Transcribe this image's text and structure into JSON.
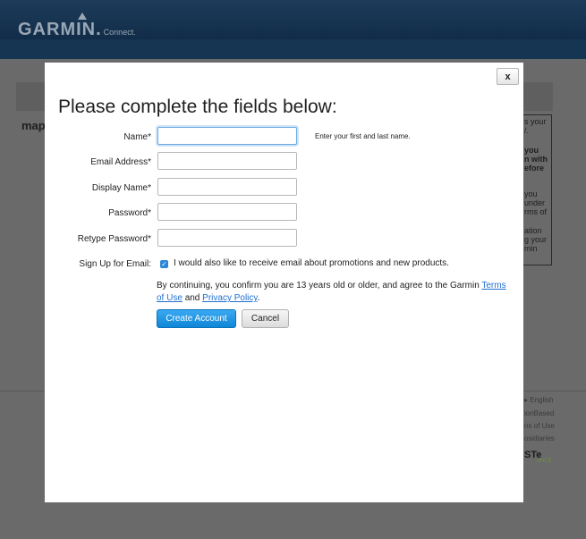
{
  "background": {
    "logo": "GARMIN.",
    "logo_sub": "Connect.",
    "left_text": "map",
    "right_panel_lines": [
      "s your",
      "/.",
      "",
      "you",
      "n with",
      "efore",
      "",
      "you",
      "under",
      "rms of",
      "",
      "ation",
      "g your",
      "min"
    ],
    "footer_lines": [
      "▸ English",
      "ionBased",
      "ns of Use",
      "osidiaries"
    ],
    "footer_logo": "STe",
    "footer_logo_sub": "ANCE"
  },
  "modal": {
    "close_label": "x",
    "title": "Please complete the fields below:",
    "fields": [
      {
        "label": "Name*",
        "value": "",
        "focused": true
      },
      {
        "label": "Email Address*",
        "value": ""
      },
      {
        "label": "Display Name*",
        "value": ""
      },
      {
        "label": "Password*",
        "value": ""
      },
      {
        "label": "Retype Password*",
        "value": ""
      }
    ],
    "name_hint": "Enter your first and last name.",
    "signup_label": "Sign Up for Email:",
    "signup_checked": true,
    "signup_text": "I would also like to receive email about promotions and new products.",
    "consent_prefix": "By continuing, you confirm you are 13 years old or older, and agree to the Garmin",
    "terms_link": "Terms of Use",
    "consent_and": "and",
    "privacy_link": "Privacy Policy",
    "consent_suffix": ".",
    "create_button": "Create Account",
    "cancel_button": "Cancel"
  }
}
